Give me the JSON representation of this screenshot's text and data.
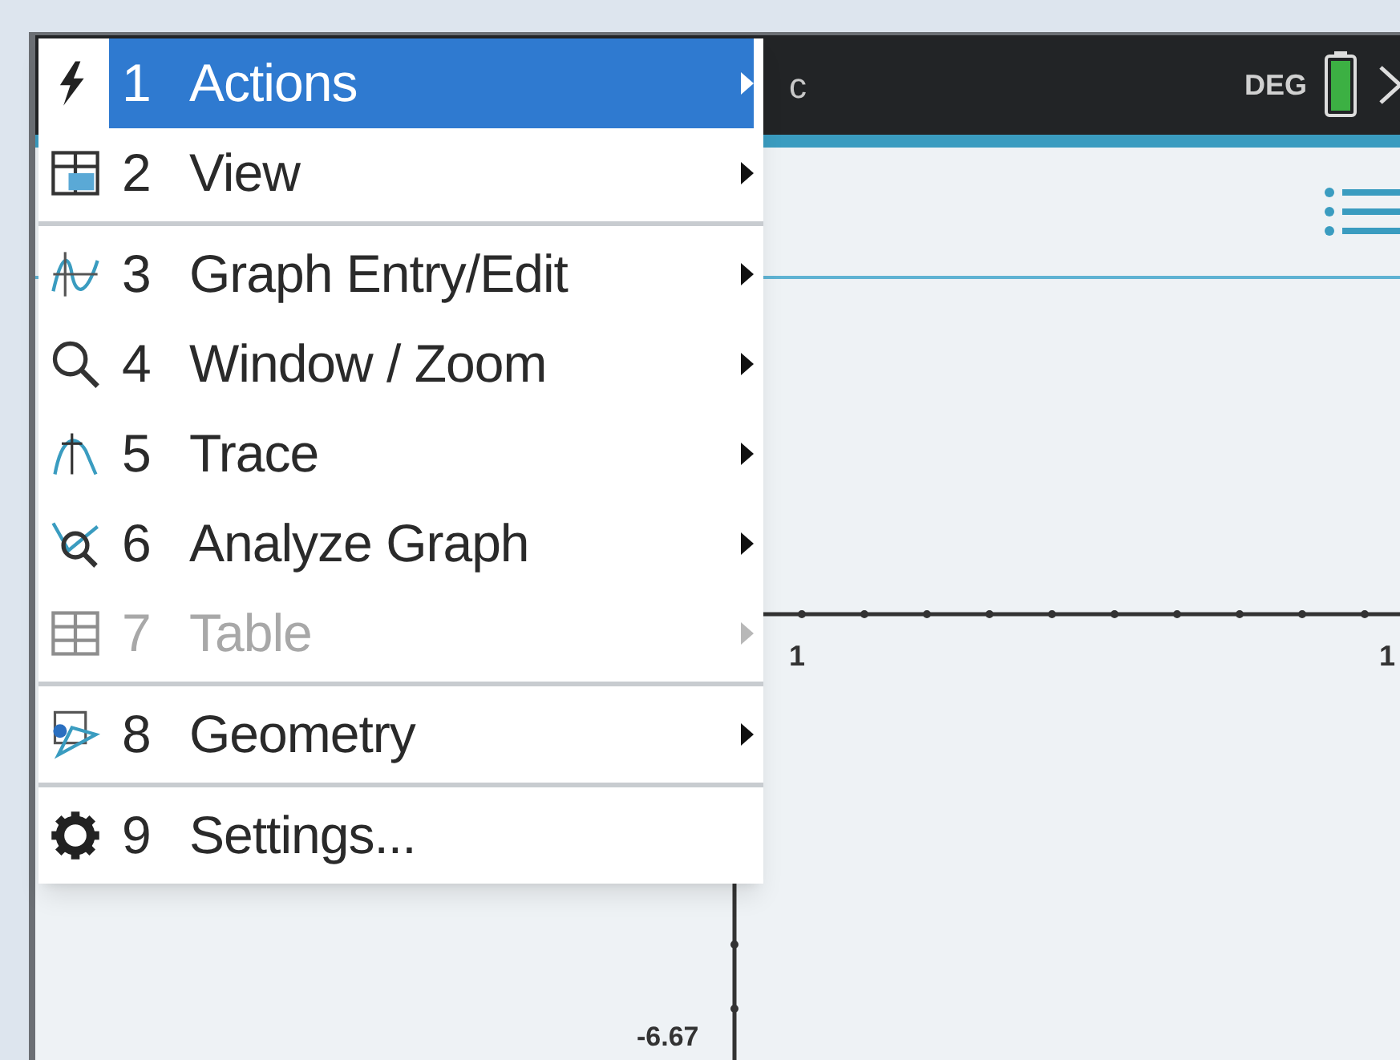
{
  "header": {
    "title_fragment": "c",
    "angle_mode": "DEG"
  },
  "menu": {
    "groups": [
      [
        {
          "number": "1",
          "label": "Actions",
          "submenu": true,
          "selected": true,
          "disabled": false
        },
        {
          "number": "2",
          "label": "View",
          "submenu": true,
          "selected": false,
          "disabled": false
        }
      ],
      [
        {
          "number": "3",
          "label": "Graph Entry/Edit",
          "submenu": true,
          "selected": false,
          "disabled": false
        },
        {
          "number": "4",
          "label": "Window / Zoom",
          "submenu": true,
          "selected": false,
          "disabled": false
        },
        {
          "number": "5",
          "label": "Trace",
          "submenu": true,
          "selected": false,
          "disabled": false
        },
        {
          "number": "6",
          "label": "Analyze Graph",
          "submenu": true,
          "selected": false,
          "disabled": false
        },
        {
          "number": "7",
          "label": "Table",
          "submenu": true,
          "selected": false,
          "disabled": true
        }
      ],
      [
        {
          "number": "8",
          "label": "Geometry",
          "submenu": true,
          "selected": false,
          "disabled": false
        }
      ],
      [
        {
          "number": "9",
          "label": "Settings...",
          "submenu": false,
          "selected": false,
          "disabled": false
        }
      ]
    ]
  },
  "graph": {
    "x_axis_labels": [
      "1",
      "1"
    ],
    "y_axis_label": "-6.67"
  }
}
